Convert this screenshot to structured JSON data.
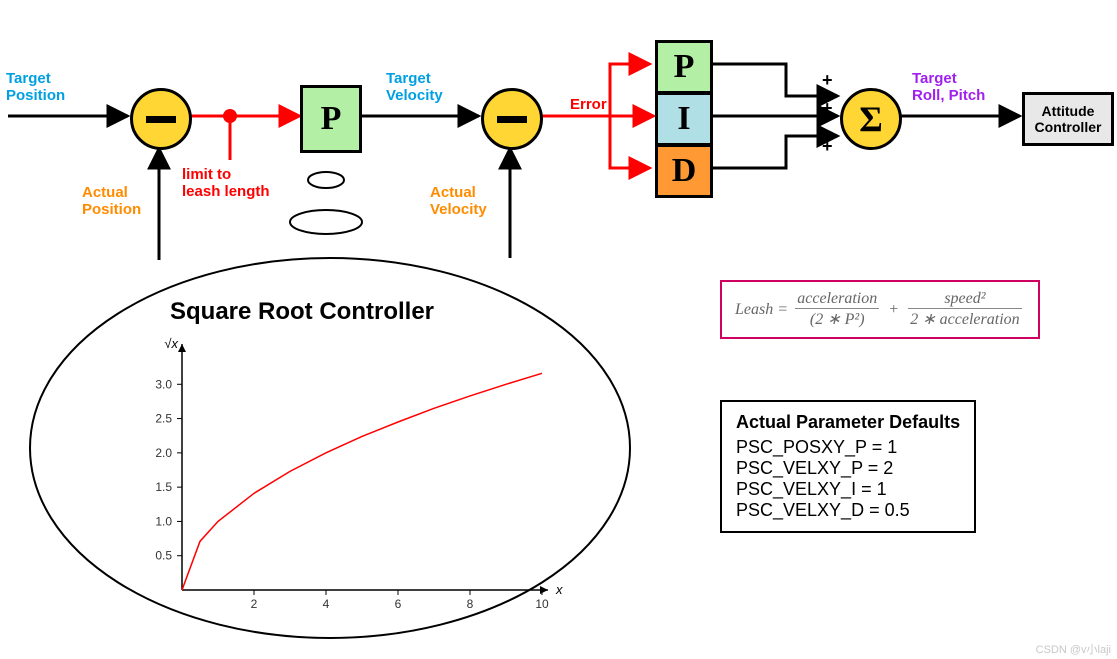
{
  "labels": {
    "target_position": "Target\nPosition",
    "actual_position": "Actual\nPosition",
    "limit": "limit to\nleash length",
    "target_velocity": "Target\nVelocity",
    "actual_velocity": "Actual\nVelocity",
    "error": "Error",
    "target_rollpitch": "Target\nRoll, Pitch",
    "attitude_ctrl": "Attitude\nController",
    "sqrt_title": "Square Root Controller"
  },
  "blocks": {
    "p1": "P",
    "p": "P",
    "i": "I",
    "d": "D",
    "sigma": "Σ"
  },
  "formula": {
    "lhs": "Leash",
    "eq": "=",
    "frac1_num": "acceleration",
    "frac1_den": "(2 ∗ P²)",
    "plus": "+",
    "frac2_num": "speed²",
    "frac2_den": "2 ∗ acceleration"
  },
  "params": {
    "title": "Actual Parameter Defaults",
    "l1": "PSC_POSXY_P = 1",
    "l2": "PSC_VELXY_P = 2",
    "l3": "PSC_VELXY_I = 1",
    "l4": "PSC_VELXY_D = 0.5"
  },
  "watermark": "CSDN @v小laji",
  "chart_data": {
    "type": "line",
    "title": "Square Root Controller",
    "xlabel": "x",
    "ylabel": "√x",
    "xlim": [
      0,
      10
    ],
    "ylim": [
      0,
      3.5
    ],
    "xticks": [
      2,
      4,
      6,
      8,
      10
    ],
    "yticks": [
      0.5,
      1.0,
      1.5,
      2.0,
      2.5,
      3.0
    ],
    "series": [
      {
        "name": "sqrt(x)",
        "x": [
          0,
          0.5,
          1,
          2,
          3,
          4,
          5,
          6,
          7,
          8,
          9,
          10
        ],
        "y": [
          0,
          0.71,
          1.0,
          1.41,
          1.73,
          2.0,
          2.24,
          2.45,
          2.65,
          2.83,
          3.0,
          3.16
        ]
      }
    ]
  }
}
